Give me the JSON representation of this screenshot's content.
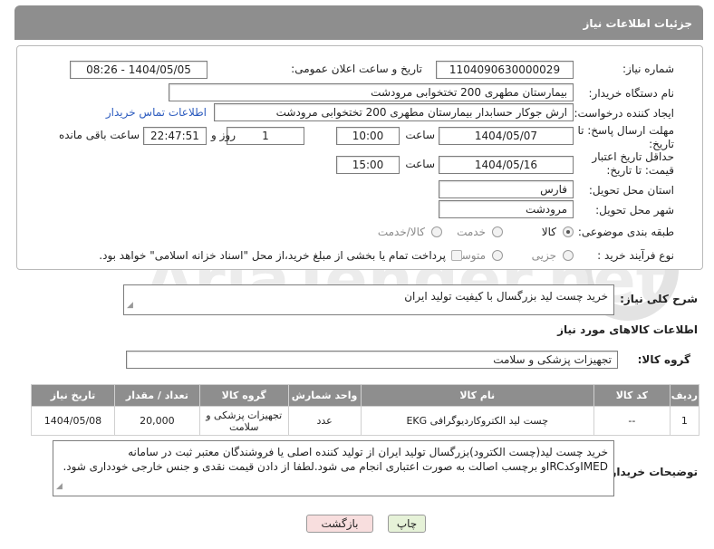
{
  "header": {
    "title": "جزئیات اطلاعات نیاز"
  },
  "form": {
    "need_number_label": "شماره نیاز:",
    "need_number": "1104090630000029",
    "announce_label": "تاریخ و ساعت اعلان عمومی:",
    "announce_value": "1404/05/05 - 08:26",
    "buyer_org_label": "نام دستگاه خریدار:",
    "buyer_org": "بیمارستان مطهری  200 تختخوابی مرودشت",
    "requester_label": "ایجاد کننده درخواست:",
    "requester": "ارش  جوکار حسابدار بیمارستان مطهری  200 تختخوابی مرودشت",
    "buyer_contact_link": "اطلاعات تماس خریدار",
    "reply_deadline_label": "مهلت ارسال پاسخ: تا تاریخ:",
    "reply_date": "1404/05/07",
    "time_label": "ساعت",
    "reply_time": "10:00",
    "days_value": "1",
    "days_label": "روز و",
    "remaining_time": "22:47:51",
    "remaining_label": "ساعت باقی مانده",
    "price_validity_label": "حداقل تاریخ اعتبار قیمت: تا تاریخ:",
    "validity_date": "1404/05/16",
    "validity_time": "15:00",
    "province_label": "استان محل تحویل:",
    "province": "فارس",
    "city_label": "شهر محل تحویل:",
    "city": "مرودشت",
    "category_label": "طبقه بندی موضوعی:",
    "category_options": [
      "کالا",
      "خدمت",
      "کالا/خدمت"
    ],
    "process_label": "نوع فرآیند خرید :",
    "process_options": [
      "جزیی",
      "متوسط"
    ],
    "payment_note": "پرداخت تمام یا بخشی از مبلغ خرید،از محل \"اسناد خزانه اسلامی\" خواهد بود."
  },
  "summary": {
    "label": "شرح کلی نیاز:",
    "value": "خرید چست لید بزرگسال با کیفیت تولید ایران"
  },
  "goods": {
    "section_title": "اطلاعات کالاهای مورد نیاز",
    "group_label": "گروه کالا:",
    "group_value": "تجهیزات پزشکی و سلامت"
  },
  "table": {
    "headers": [
      "ردیف",
      "کد کالا",
      "نام کالا",
      "واحد شمارش",
      "گروه کالا",
      "تعداد / مقدار",
      "تاریخ نیاز"
    ],
    "rows": [
      [
        "1",
        "--",
        "چست لید الکتروکاردیوگرافی EKG",
        "عدد",
        "تجهیزات پزشکی و سلامت",
        "20,000",
        "1404/05/08"
      ]
    ]
  },
  "buyer_notes": {
    "label": "توضیحات خریدار:",
    "value": "خرید چست لید(چست الکترود)بزرگسال تولید ایران از تولید کننده اصلی یا فروشندگان معتبر ثبت در سامانه IMEDوکدIRCو برچسب اصالت به صورت اعتباری انجام می شود.لطفا از دادن قیمت نقدی و جنس خارجی خودداری شود."
  },
  "buttons": {
    "print": "چاپ",
    "back": "بازگشت"
  },
  "watermark": {
    "text": "AriaTender.net"
  },
  "colors": {
    "header_bg": "#8e8e8e",
    "link": "#2d5cbf",
    "back_btn": "#f8dede",
    "print_btn": "#e6f2d8"
  }
}
